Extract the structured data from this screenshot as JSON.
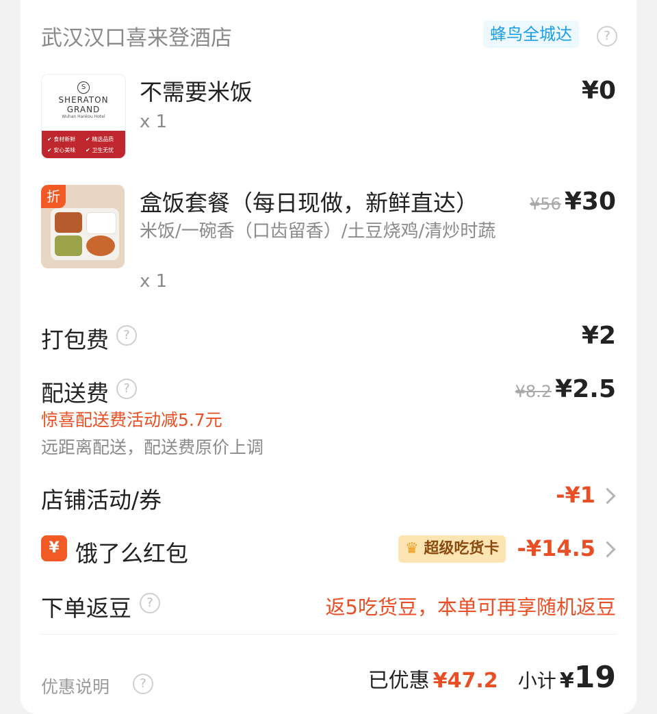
{
  "store": {
    "name": "武汉汉口喜来登酒店",
    "delivery_badge": "蜂鸟全城达"
  },
  "items": [
    {
      "name": "不需要米饭",
      "qty": "x 1",
      "price": "¥0",
      "thumb_logo_line1": "SHERATON",
      "thumb_logo_line2": "GRAND",
      "thumb_logo_line3": "Wuhan Hankou Hotel",
      "thumb_tags": [
        "食材新鲜",
        "精选品质",
        "安心美味",
        "卫生无忧"
      ]
    },
    {
      "name": "盒饭套餐（每日现做，新鲜直达）",
      "desc": "米饭/一碗香（口齿留香）/土豆烧鸡/清炒时蔬",
      "qty": "x 1",
      "orig_price": "¥56",
      "price": "¥30",
      "discount_tag": "折"
    }
  ],
  "fees": {
    "packing_label": "打包费",
    "packing_price": "¥2",
    "delivery_label": "配送费",
    "delivery_orig": "¥8.2",
    "delivery_price": "¥2.5",
    "delivery_promo": "惊喜配送费活动减5.7元",
    "delivery_note": "远距离配送，配送费原价上调"
  },
  "discounts": {
    "store_activity_label": "店铺活动/券",
    "store_activity_value": "-¥1",
    "redpacket_icon": "¥",
    "redpacket_label": "饿了么红包",
    "super_badge": "超级吃货卡",
    "redpacket_value": "-¥14.5",
    "beans_label": "下单返豆",
    "beans_value": "返5吃货豆，本单可再享随机返豆"
  },
  "footer": {
    "note_label": "优惠说明",
    "saved_label": "已优惠",
    "saved_value": "¥47.2",
    "subtotal_label": "小计",
    "subtotal_currency": "¥",
    "subtotal_value": "19"
  },
  "colors": {
    "accent_red": "#e94f24",
    "badge_blue": "#1a9ee6",
    "sheraton_red": "#c0262d"
  }
}
